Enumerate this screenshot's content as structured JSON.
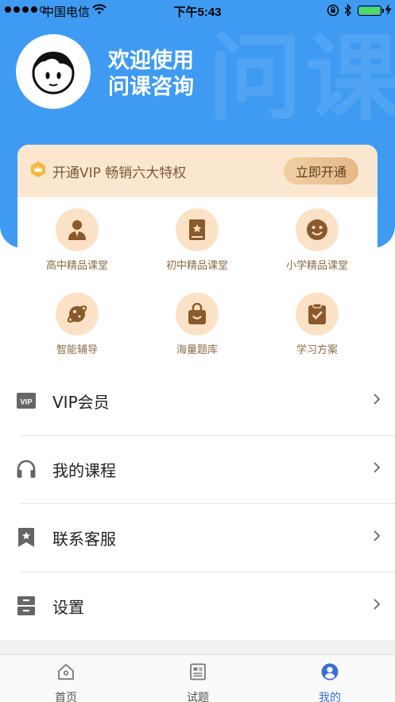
{
  "status_bar": {
    "carrier": "中国电信",
    "time": "下午5:43"
  },
  "header": {
    "watermark": "问课",
    "welcome_line1": "欢迎使用",
    "welcome_line2": "问课咨询"
  },
  "vip": {
    "banner_text": "开通VIP 畅销六大特权",
    "button_label": "立即开通"
  },
  "features": [
    {
      "label": "高中精品课堂",
      "icon": "teacher-icon"
    },
    {
      "label": "初中精品课堂",
      "icon": "book-icon"
    },
    {
      "label": "小学精品课堂",
      "icon": "smiley-icon"
    },
    {
      "label": "智能辅导",
      "icon": "planet-icon"
    },
    {
      "label": "海量题库",
      "icon": "bag-icon"
    },
    {
      "label": "学习方案",
      "icon": "clipboard-check-icon"
    }
  ],
  "menu": [
    {
      "label": "VIP会员",
      "icon": "vip-icon"
    },
    {
      "label": "我的课程",
      "icon": "headphones-icon"
    },
    {
      "label": "联系客服",
      "icon": "bookmark-star-icon"
    },
    {
      "label": "设置",
      "icon": "drawer-icon"
    }
  ],
  "tabs": [
    {
      "label": "首页",
      "icon": "home-icon"
    },
    {
      "label": "试题",
      "icon": "document-icon"
    },
    {
      "label": "我的",
      "icon": "user-circle-icon"
    }
  ],
  "colors": {
    "brand_blue": "#3f9bf2",
    "vip_banner_bg": "#fbe7d0",
    "feature_text": "#8a6b45",
    "tab_active": "#3a6fd8"
  }
}
